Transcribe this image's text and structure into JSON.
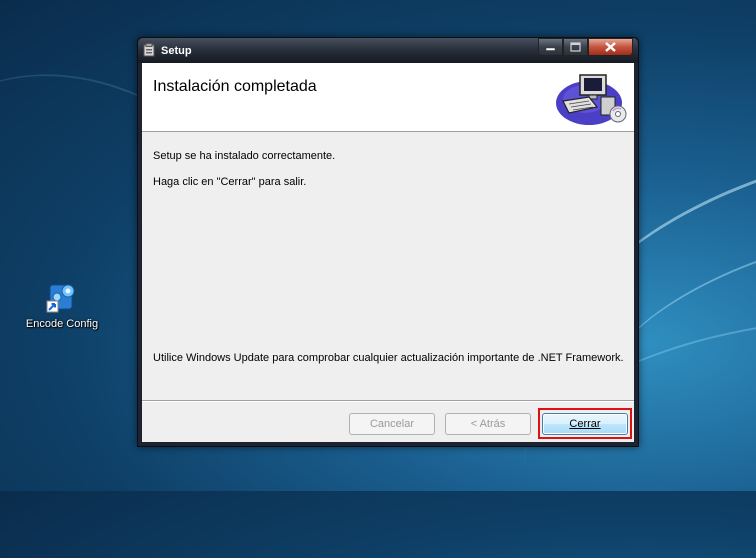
{
  "desktop": {
    "icon_label": "Encode Config",
    "icon_name": "encode-config-shortcut-icon"
  },
  "window": {
    "title": "Setup",
    "title_icon": "setup-icon",
    "caption_buttons": [
      "minimize-icon",
      "maximize-icon",
      "close-icon"
    ]
  },
  "header": {
    "title": "Instalación completada",
    "art": "computer-setup-icon"
  },
  "body": {
    "line1": "Setup se ha instalado correctamente.",
    "line2": "Haga clic en \"Cerrar\" para salir.",
    "footer_note": "Utilice Windows Update para comprobar cualquier actualización importante de .NET Framework."
  },
  "buttons": {
    "cancel": "Cancelar",
    "back": "< Atrás",
    "close": "Cerrar"
  },
  "colors": {
    "highlight": "#e01010",
    "titlebar": "#2a313d",
    "dialog_bg": "#efefef"
  }
}
